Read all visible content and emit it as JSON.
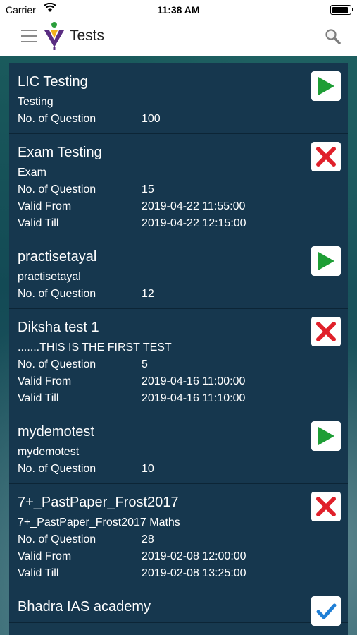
{
  "status_bar": {
    "carrier": "Carrier",
    "time": "11:38 AM"
  },
  "header": {
    "title": "Tests"
  },
  "labels": {
    "questions": "No. of Question",
    "valid_from": "Valid From",
    "valid_till": "Valid Till"
  },
  "tests": [
    {
      "name": "LIC Testing",
      "description": "Testing",
      "questions": "100",
      "status": "play"
    },
    {
      "name": "Exam Testing",
      "description": "Exam",
      "questions": "15",
      "valid_from": "2019-04-22 11:55:00",
      "valid_till": "2019-04-22 12:15:00",
      "status": "expired"
    },
    {
      "name": "practisetayal",
      "description": "practisetayal",
      "questions": "12",
      "status": "play"
    },
    {
      "name": "Diksha test 1",
      "description": ".......THIS IS THE FIRST TEST",
      "questions": "5",
      "valid_from": "2019-04-16 11:00:00",
      "valid_till": "2019-04-16 11:10:00",
      "status": "expired"
    },
    {
      "name": "mydemotest",
      "description": "mydemotest",
      "questions": "10",
      "status": "play"
    },
    {
      "name": "7+_PastPaper_Frost2017",
      "description": "7+_PastPaper_Frost2017 Maths",
      "questions": "28",
      "valid_from": "2019-02-08 12:00:00",
      "valid_till": "2019-02-08 13:25:00",
      "status": "expired"
    },
    {
      "name": "Bhadra IAS academy",
      "status": "completed"
    }
  ],
  "colors": {
    "play": "#1e9e35",
    "expired": "#e0202a",
    "completed": "#1f7fd6"
  }
}
